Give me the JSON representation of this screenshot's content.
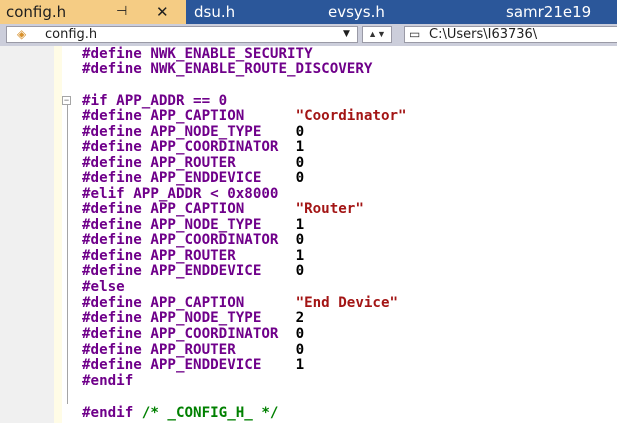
{
  "tabs": [
    {
      "label": "config.h",
      "active": true
    },
    {
      "label": "dsu.h",
      "active": false
    },
    {
      "label": "evsys.h",
      "active": false
    },
    {
      "label": "samr21e19",
      "active": false
    }
  ],
  "navigation": {
    "file_combo": "config.h",
    "path_combo": "C:\\Users\\I63736\\"
  },
  "code_lines": [
    {
      "directive": "#define",
      "name": "NWK_ENABLE_SECURITY",
      "value": ""
    },
    {
      "directive": "#define",
      "name": "NWK_ENABLE_ROUTE_DISCOVERY",
      "value": ""
    },
    {
      "directive": "#if",
      "name": "APP_ADDR == 0",
      "value": ""
    },
    {
      "directive": "#define",
      "name": "APP_CAPTION",
      "value": "\"Coordinator\""
    },
    {
      "directive": "#define",
      "name": "APP_NODE_TYPE",
      "value": "0"
    },
    {
      "directive": "#define",
      "name": "APP_COORDINATOR",
      "value": "1"
    },
    {
      "directive": "#define",
      "name": "APP_ROUTER",
      "value": "0"
    },
    {
      "directive": "#define",
      "name": "APP_ENDDEVICE",
      "value": "0"
    },
    {
      "directive": "#elif",
      "name": "APP_ADDR < 0x8000",
      "value": ""
    },
    {
      "directive": "#define",
      "name": "APP_CAPTION",
      "value": "\"Router\""
    },
    {
      "directive": "#define",
      "name": "APP_NODE_TYPE",
      "value": "1"
    },
    {
      "directive": "#define",
      "name": "APP_COORDINATOR",
      "value": "0"
    },
    {
      "directive": "#define",
      "name": "APP_ROUTER",
      "value": "1"
    },
    {
      "directive": "#define",
      "name": "APP_ENDDEVICE",
      "value": "0"
    },
    {
      "directive": "#else",
      "name": "",
      "value": ""
    },
    {
      "directive": "#define",
      "name": "APP_CAPTION",
      "value": "\"End Device\""
    },
    {
      "directive": "#define",
      "name": "APP_NODE_TYPE",
      "value": "2"
    },
    {
      "directive": "#define",
      "name": "APP_COORDINATOR",
      "value": "0"
    },
    {
      "directive": "#define",
      "name": "APP_ROUTER",
      "value": "0"
    },
    {
      "directive": "#define",
      "name": "APP_ENDDEVICE",
      "value": "1"
    },
    {
      "directive": "#endif",
      "name": "",
      "value": ""
    },
    {
      "directive": "#endif",
      "name": "/* _CONFIG_H_ */",
      "value": ""
    }
  ],
  "colors": {
    "tabbar_bg": "#2b579a",
    "active_tab_bg": "#f5cc84",
    "preprocessor": "#6f008a",
    "string": "#a31515",
    "comment": "#008000"
  }
}
